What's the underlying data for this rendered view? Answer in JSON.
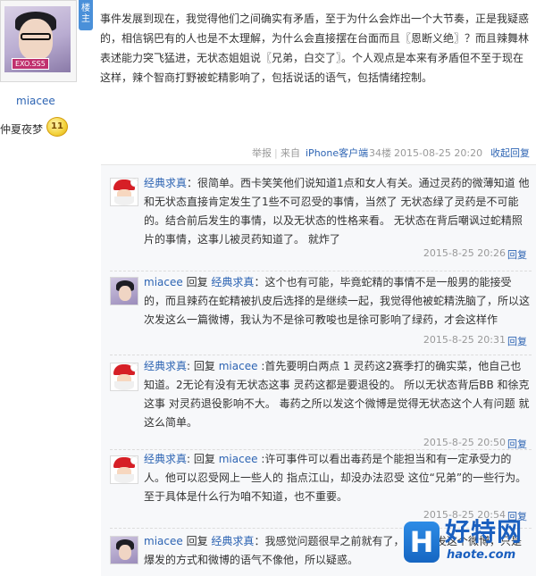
{
  "user": {
    "owner_badge": "楼主",
    "avatar_tag": "EXO.SS5",
    "name": "miacee",
    "title": "仲夏夜梦",
    "level": "11"
  },
  "post": {
    "content": "事件发展到现在，我觉得他们之间确实有矛盾，至于为什么会炸出一个大节奏，正是我疑惑的，相信锅巴有的人也是不太理解，为什么会直接摆在台面而且〖恩断义绝〗？而且辣舞林表述能力突飞猛进，无状态姐姐说〖兄弟，白交了〗。个人观点是本来有矛盾但不至于现在这样，辣个智商打野被蛇精影响了，包括说话的语气，包括情绪控制。",
    "tail": {
      "report": "举报",
      "separator": "|",
      "from": "来自",
      "client": "iPhone客户端",
      "floor": "34楼",
      "time": "2015-08-25 20:20",
      "collapse": "收起回复"
    }
  },
  "replies": [
    {
      "author": "经典求真",
      "colon": "：",
      "reply_word": "",
      "target": "",
      "text": "很简单。西卡笑笑他们说知道1点和女人有关。通过灵药的微薄知道 他和无状态直接肯定发生了1些不可忍受的事情，当然了 无状态绿了灵药是不可能的。结合前后发生的事情，以及无状态的性格来看。 无状态在背后嘲讽过蛇精照片的事情，这事儿被灵药知道了。 就炸了",
      "time": "2015-8-25 20:26",
      "action": "回复"
    },
    {
      "author": "miacee",
      "colon": "",
      "reply_word": "回复",
      "target": "经典求真",
      "text": "：这个也有可能，毕竟蛇精的事情不是一般男的能接受的，而且辣药在蛇精被扒皮后选择的是继续一起，我觉得他被蛇精洗脑了，所以这次发这么一篇微博，我认为不是徐可教唆也是徐可影响了绿药，才会这样作",
      "time": "2015-8-25 20:31",
      "action": "回复"
    },
    {
      "author": "经典求真",
      "colon": ":",
      "reply_word": "回复",
      "target": "miacee",
      "text": ":首先要明白两点 1 灵药这2赛季打的确实菜，他自己也知道。2无论有没有无状态这事 灵药这都是要退役的。 所以无状态背后BB 和徐克这事 对灵药退役影响不大。 毒药之所以发这个微博是觉得无状态这个人有问题 就这么简单。",
      "time": "2015-8-25 20:50",
      "action": "回复"
    },
    {
      "author": "经典求真",
      "colon": ":",
      "reply_word": "回复",
      "target": "miacee",
      "text": ":许可事件可以看出毒药是个能担当和有一定承受力的人。他可以忍受网上一些人的 指点江山，却没办法忍受 这位“兄弟”的一些行为。至于具体是什么行为咱不知道，也不重要。",
      "time": "2015-8-25 20:54",
      "action": "回复"
    },
    {
      "author": "miacee",
      "colon": "",
      "reply_word": "回复",
      "target": "经典求真",
      "text": "：我感觉问题很早之前就有了，",
      "text_after": "发这个微博，只是",
      "text_line2": "爆发的方式和微博的语气不像他，所以疑惑。",
      "time": "",
      "action": ""
    }
  ],
  "watermark": {
    "icon_letter": "H",
    "title": "好特网",
    "url": "haote.com"
  },
  "colors": {
    "link": "#2d64b3",
    "meta": "#999999",
    "reply_bg": "#f7f8fa",
    "santa_hat": "#d61f26",
    "level_badge": "#f3d23c",
    "owner_badge": "#4a90d9"
  },
  "icons": [
    "santa-avatar",
    "user-avatar",
    "level-badge",
    "haote-logo-icon"
  ]
}
